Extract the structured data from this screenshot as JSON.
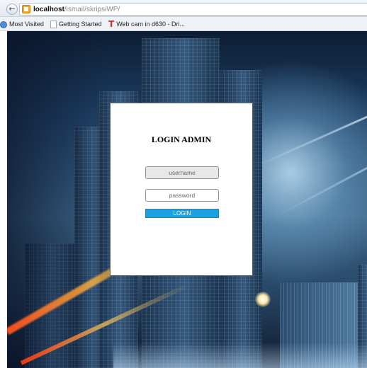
{
  "browser": {
    "url_host": "localhost",
    "url_path": "/ismail/skripsiWP/",
    "bookmarks": [
      {
        "label": "Most Visited",
        "icon": "globe-icon"
      },
      {
        "label": "Getting Started",
        "icon": "page-icon"
      },
      {
        "label": "Web cam in d630 - Dri...",
        "icon": "t-brand-icon"
      }
    ]
  },
  "login": {
    "title": "LOGIN ADMIN",
    "username_placeholder": "username",
    "password_placeholder": "password",
    "button_label": "LOGIN",
    "button_color": "#1ba1e2"
  }
}
